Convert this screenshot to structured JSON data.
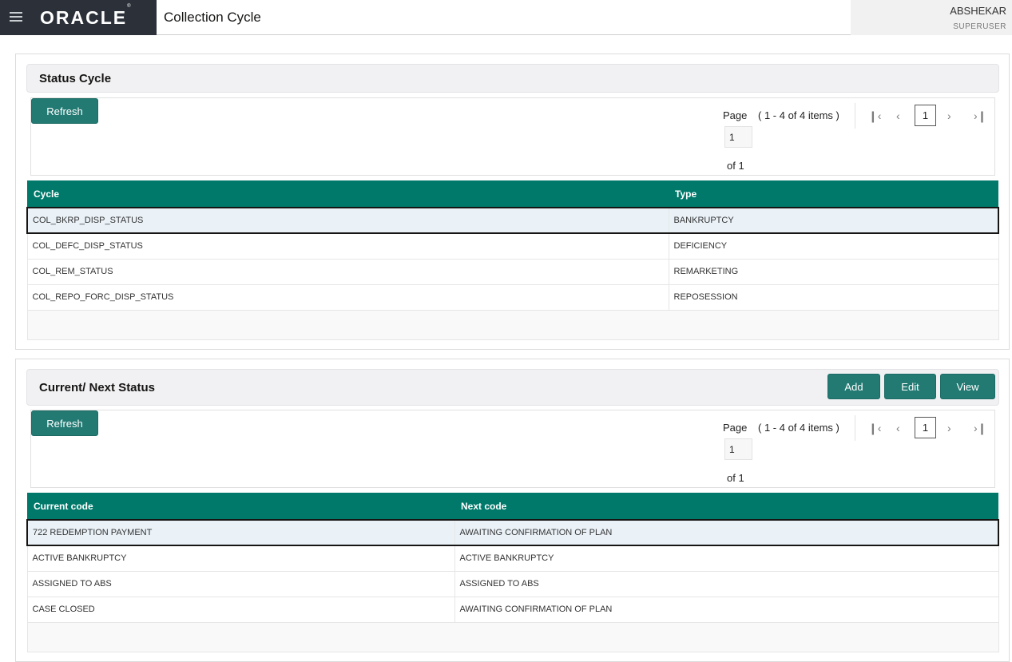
{
  "header": {
    "menu_icon": "hamburger-icon",
    "logo_text": "ORACLE",
    "logo_mark": "®",
    "app_title": "Collection Cycle",
    "user_name": "ABSHEKAR",
    "user_role": "SUPERUSER"
  },
  "status_cycle": {
    "title": "Status Cycle",
    "refresh_label": "Refresh",
    "pager": {
      "page_label": "Page",
      "range": "( 1 - 4 of 4 items )",
      "page_value": "1",
      "of_label": "of 1",
      "current": "1"
    },
    "columns": [
      "Cycle",
      "Type"
    ],
    "rows": [
      [
        "COL_BKRP_DISP_STATUS",
        "BANKRUPTCY"
      ],
      [
        "COL_DEFC_DISP_STATUS",
        "DEFICIENCY"
      ],
      [
        "COL_REM_STATUS",
        "REMARKETING"
      ],
      [
        "COL_REPO_FORC_DISP_STATUS",
        "REPOSESSION"
      ]
    ]
  },
  "current_next": {
    "title": "Current/ Next Status",
    "add_label": "Add",
    "edit_label": "Edit",
    "view_label": "View",
    "refresh_label": "Refresh",
    "pager": {
      "page_label": "Page",
      "range": "( 1 - 4 of 4 items )",
      "page_value": "1",
      "of_label": "of 1",
      "current": "1"
    },
    "columns": [
      "Current code",
      "Next code"
    ],
    "rows": [
      [
        "722 REDEMPTION PAYMENT",
        "AWAITING CONFIRMATION OF PLAN"
      ],
      [
        "ACTIVE BANKRUPTCY",
        "ACTIVE BANKRUPTCY"
      ],
      [
        "ASSIGNED TO ABS",
        "ASSIGNED TO ABS"
      ],
      [
        "CASE CLOSED",
        "AWAITING CONFIRMATION OF PLAN"
      ]
    ]
  },
  "colors": {
    "accent": "#00796b",
    "button": "#227a73",
    "brand_bg": "#2b3039"
  }
}
